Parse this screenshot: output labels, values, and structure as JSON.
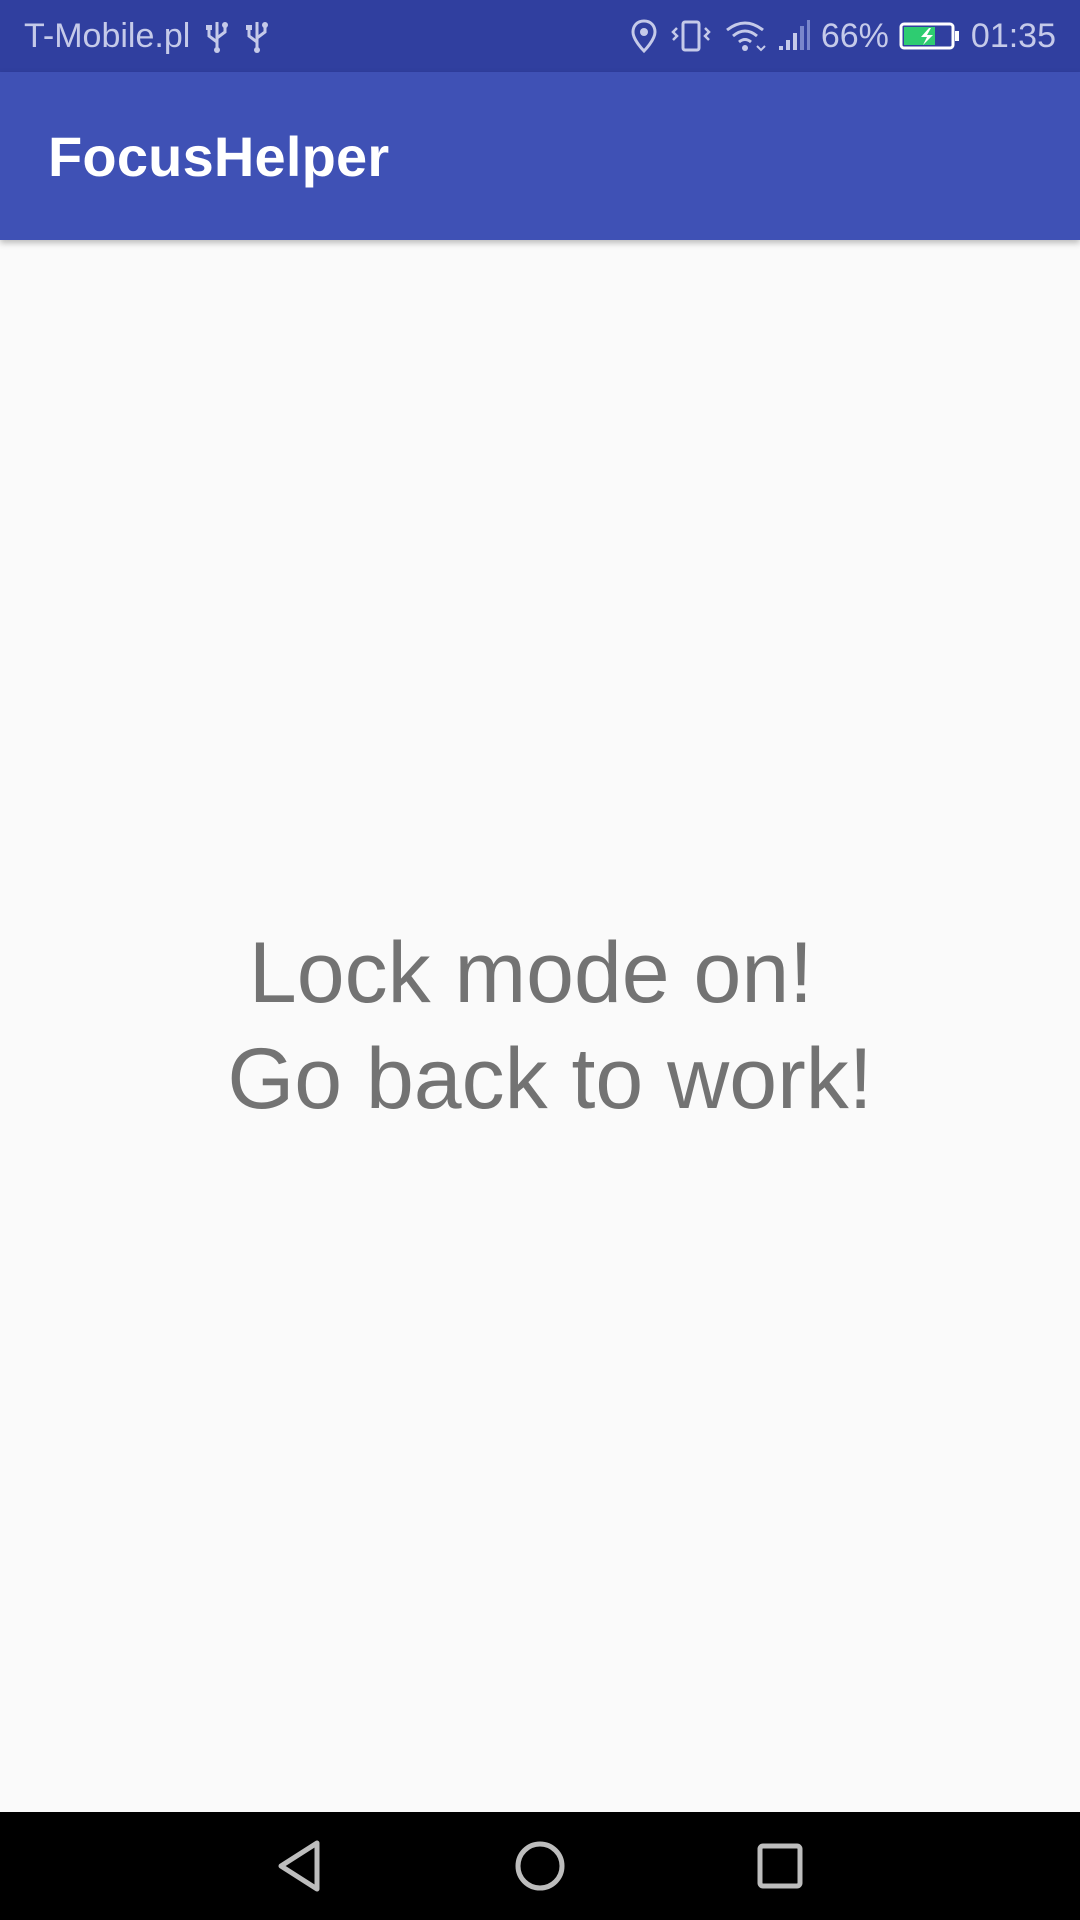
{
  "status_bar": {
    "carrier": "T-Mobile.pl",
    "battery_percent": "66%",
    "battery_level": 0.66,
    "time": "01:35",
    "left_icons": [
      "usb-icon",
      "usb-icon"
    ],
    "right_icons": [
      "location-icon",
      "vibrate-icon",
      "wifi-icon",
      "signal-icon",
      "battery-charging-icon"
    ],
    "background_color": "#303F9F"
  },
  "app_bar": {
    "title": "FocusHelper",
    "background_color": "#3F51B5"
  },
  "main": {
    "message_line1": "Lock mode on!",
    "message_line2": "Go back to work!",
    "text_color": "#737373",
    "background_color": "#FAFAFA"
  },
  "nav_bar": {
    "buttons": [
      "back-icon",
      "home-icon",
      "recents-icon"
    ]
  }
}
